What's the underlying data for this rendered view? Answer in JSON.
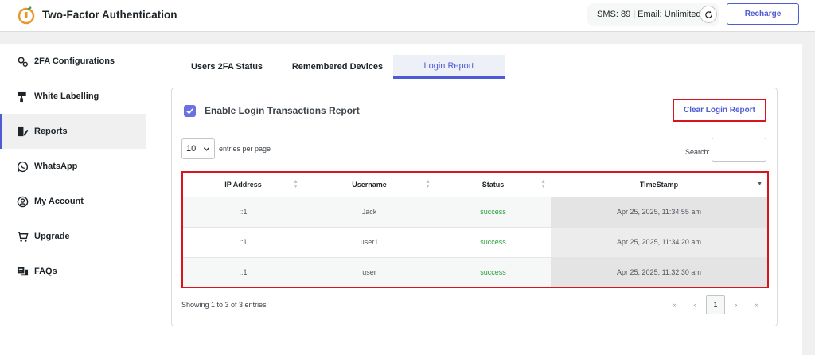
{
  "header": {
    "title": "Two-Factor Authentication",
    "credits": "SMS: 89 | Email: Unlimited",
    "recharge_label": "Recharge",
    "logo_color": "#e8952b"
  },
  "sidebar": {
    "items": [
      {
        "label": "2FA Configurations",
        "icon": "gears-icon"
      },
      {
        "label": "White Labelling",
        "icon": "paint-roller-icon"
      },
      {
        "label": "Reports",
        "icon": "report-icon"
      },
      {
        "label": "WhatsApp",
        "icon": "whatsapp-icon"
      },
      {
        "label": "My Account",
        "icon": "user-circle-icon"
      },
      {
        "label": "Upgrade",
        "icon": "cart-icon"
      },
      {
        "label": "FAQs",
        "icon": "faq-icon"
      }
    ],
    "active": "Reports"
  },
  "tabs": [
    {
      "label": "Users 2FA Status"
    },
    {
      "label": "Remembered Devices"
    },
    {
      "label": "Login Report"
    }
  ],
  "active_tab": "Login Report",
  "report": {
    "enable_label": "Enable Login Transactions Report",
    "enabled": true,
    "clear_label": "Clear Login Report",
    "page_length": "10",
    "entries_label": "entries per page",
    "search_label": "Search:",
    "columns": [
      "IP Address",
      "Username",
      "Status",
      "TimeStamp"
    ],
    "rows": [
      {
        "ip": "::1",
        "username": "Jack",
        "status": "success",
        "timestamp": "Apr 25, 2025, 11:34:55 am"
      },
      {
        "ip": "::1",
        "username": "user1",
        "status": "success",
        "timestamp": "Apr 25, 2025, 11:34:20 am"
      },
      {
        "ip": "::1",
        "username": "user",
        "status": "success",
        "timestamp": "Apr 25, 2025, 11:32:30 am"
      }
    ],
    "info": "Showing 1 to 3 of 3 entries",
    "pagination": {
      "first": "«",
      "prev": "‹",
      "current": "1",
      "next": "›",
      "last": "»"
    }
  },
  "colors": {
    "accent": "#4f5bd5",
    "highlight": "#d9141f",
    "success": "#2a9d3a"
  }
}
